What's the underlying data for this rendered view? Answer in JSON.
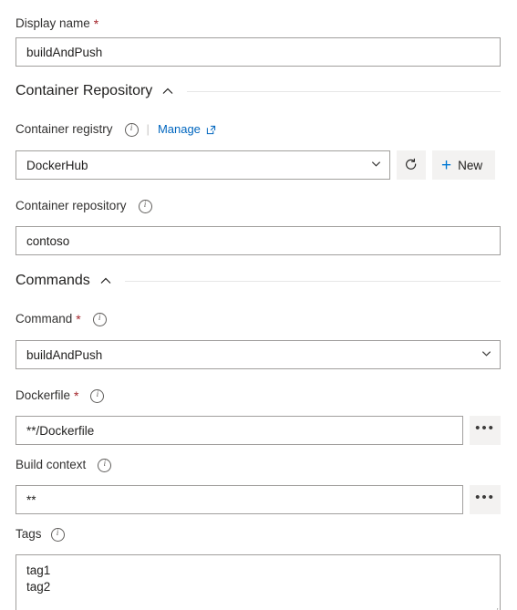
{
  "form": {
    "display_name": {
      "label": "Display name",
      "required_marker": "*",
      "value": "buildAndPush"
    },
    "sections": [
      {
        "title": "Container Repository",
        "collapse_icon": "chevron-up-icon"
      },
      {
        "title": "Commands",
        "collapse_icon": "chevron-up-icon"
      }
    ],
    "container_registry": {
      "label": "Container registry",
      "info_icon": "info-icon",
      "separator": "|",
      "manage_link": "Manage",
      "external_icon": "external-link-icon",
      "value": "DockerHub",
      "chevron_icon": "chevron-down-icon",
      "refresh_icon": "refresh-icon",
      "new_label": "New",
      "plus_icon": "plus-icon"
    },
    "container_repository": {
      "label": "Container repository",
      "info_icon": "info-icon",
      "value": "contoso"
    },
    "command": {
      "label": "Command",
      "required_marker": "*",
      "info_icon": "info-icon",
      "value": "buildAndPush",
      "chevron_icon": "chevron-down-icon"
    },
    "dockerfile": {
      "label": "Dockerfile",
      "required_marker": "*",
      "info_icon": "info-icon",
      "value": "**/Dockerfile",
      "browse_label": "•••"
    },
    "build_context": {
      "label": "Build context",
      "info_icon": "info-icon",
      "value": "**",
      "browse_label": "•••"
    },
    "tags": {
      "label": "Tags",
      "info_icon": "info-icon",
      "value": "tag1\ntag2"
    }
  },
  "colors": {
    "accent": "#0078d4",
    "link": "#0066bf",
    "required": "#a4262c",
    "border": "#a19f9d",
    "button_bg": "#f3f2f1",
    "rule": "#e6e6e6"
  }
}
